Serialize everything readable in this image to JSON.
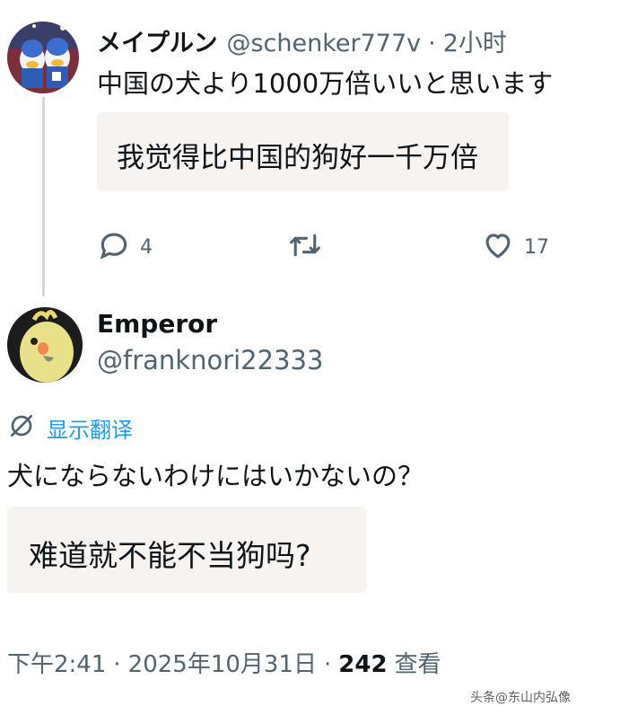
{
  "tweet1": {
    "display_name": "メイプルン",
    "handle": "@schenker777v",
    "separator": "·",
    "time": "2小时",
    "text": "中国の犬より1000万倍いいと思います",
    "translation": "我觉得比中国的狗好一千万倍",
    "actions": {
      "reply_count": "4",
      "retweet_count": "",
      "like_count": "17"
    }
  },
  "tweet2": {
    "display_name": "Emperor",
    "handle": "@franknori22333",
    "translate_label": "显示翻译",
    "text": "犬にならないわけにはいかないの？",
    "translation": "难道就不能不当狗吗?",
    "meta": {
      "time": "下午2:41",
      "separator": "·",
      "date": "2025年10月31日",
      "views_count": "242",
      "views_label": "查看"
    }
  },
  "watermark": "头条@东山内弘像",
  "colors": {
    "text_primary": "#0f1419",
    "text_secondary": "#536471",
    "link_blue": "#1d9bf0",
    "translation_bg": "#f6f3f1",
    "thread_line": "#cfd9de"
  },
  "icons": {
    "reply": "speech-bubble-icon",
    "retweet": "retweet-icon",
    "like": "heart-icon",
    "translate": "globe-slash-icon"
  }
}
